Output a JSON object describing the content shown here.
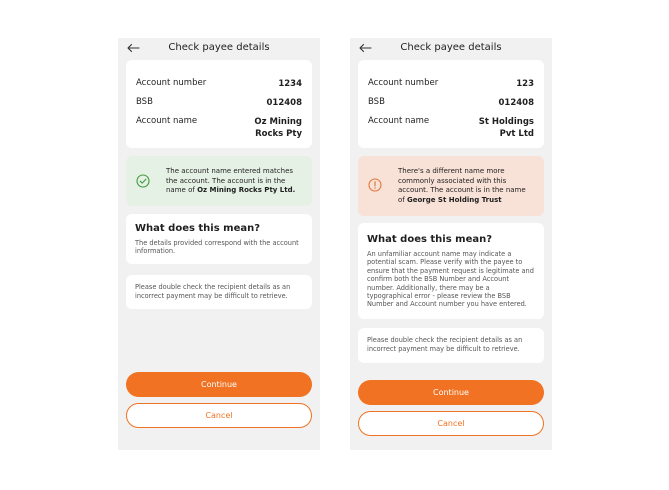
{
  "colors": {
    "accent": "#f07222",
    "success_bg": "#e6f1e6",
    "success_icon": "#3c9a3c",
    "warning_bg": "#f8e1d6",
    "warning_icon": "#e0763a",
    "screen_bg": "#f1f1f1"
  },
  "screens": [
    {
      "header": {
        "title": "Check payee details",
        "back_icon": "back-arrow-icon"
      },
      "details": {
        "account_number_label": "Account number",
        "account_number_value": "1234",
        "bsb_label": "BSB",
        "bsb_value": "012408",
        "account_name_label": "Account name",
        "account_name_value_line1": "Oz Mining",
        "account_name_value_line2": "Rocks Pty"
      },
      "message": {
        "type": "success",
        "icon": "check-circle-icon",
        "text": "The account name entered matches the account. The account is in the name of ",
        "name": "Oz Mining Rocks Pty Ltd."
      },
      "info": {
        "title": "What does this mean?",
        "body": "The details provided correspond with the account information."
      },
      "note": "Please double check the recipient details as an incorrect payment may be difficult to retrieve.",
      "continue_label": "Continue",
      "cancel_label": "Cancel"
    },
    {
      "header": {
        "title": "Check payee details",
        "back_icon": "back-arrow-icon"
      },
      "details": {
        "account_number_label": "Account number",
        "account_number_value": "123",
        "bsb_label": "BSB",
        "bsb_value": "012408",
        "account_name_label": "Account name",
        "account_name_value_line1": "St Holdings",
        "account_name_value_line2": "Pvt Ltd"
      },
      "message": {
        "type": "warning",
        "icon": "alert-circle-icon",
        "text": "There's a different name more commonly associated with this account. The account is in the name of ",
        "name": "George St Holding Trust"
      },
      "info": {
        "title": "What does this mean?",
        "body": "An unfamiliar account name may indicate a potential scam. Please verify with the payee to ensure that the payment request is legitimate and confirm both the BSB Number and Account number. Additionally, there may be a typographical error - please review the BSB Number and Account number you have entered."
      },
      "note": "Please double check the recipient details as an incorrect payment may be difficult to retrieve.",
      "continue_label": "Continue",
      "cancel_label": "Cancel"
    }
  ]
}
